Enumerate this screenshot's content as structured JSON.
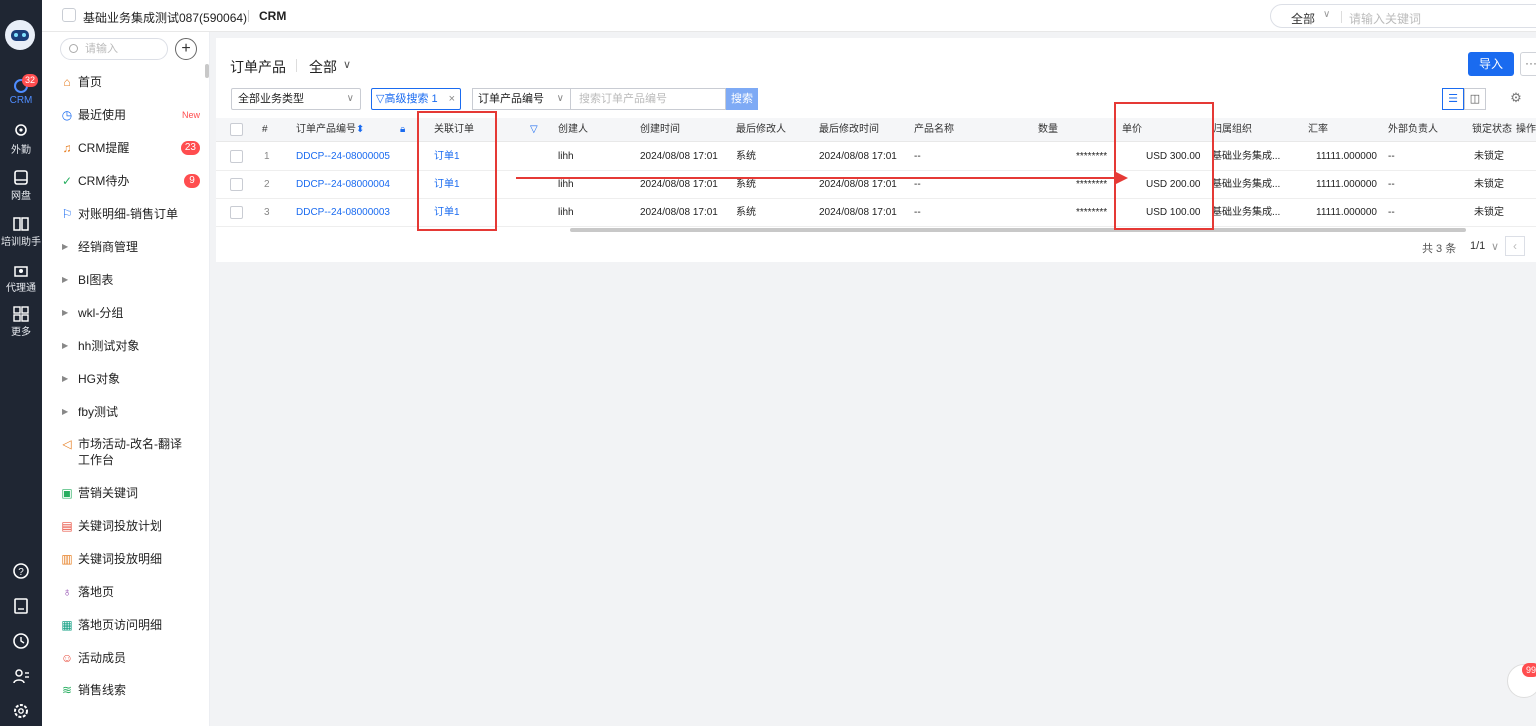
{
  "rail": {
    "items": [
      {
        "label": "CRM",
        "badge": "32"
      },
      {
        "label": "外勤"
      },
      {
        "label": "网盘"
      },
      {
        "label": "培训助手"
      },
      {
        "label": "代理通"
      },
      {
        "label": "更多"
      }
    ]
  },
  "topbar": {
    "tenant": "基础业务集成测试087(590064)",
    "module": "CRM",
    "scope": "全部",
    "search_placeholder": "请输入关键词"
  },
  "menu": {
    "search_placeholder": "请输入",
    "items": [
      {
        "label": "首页",
        "icon": "home-icon"
      },
      {
        "label": "最近使用",
        "icon": "clock-icon",
        "tag": "New"
      },
      {
        "label": "CRM提醒",
        "icon": "bell-icon",
        "count": "23"
      },
      {
        "label": "CRM待办",
        "icon": "check-circle-icon",
        "count": "9"
      },
      {
        "label": "对账明细-销售订单",
        "icon": "flag-icon"
      },
      {
        "label": "经销商管理"
      },
      {
        "label": "BI图表"
      },
      {
        "label": "wkl-分组"
      },
      {
        "label": "hh测试对象"
      },
      {
        "label": "HG对象"
      },
      {
        "label": "fby测试"
      },
      {
        "label": "市场活动-改名-翻译工作台",
        "icon": "megaphone-icon"
      },
      {
        "label": "营销关键词",
        "icon": "keyword-icon"
      },
      {
        "label": "关键词投放计划",
        "icon": "plan-icon"
      },
      {
        "label": "关键词投放明细",
        "icon": "detail-icon"
      },
      {
        "label": "落地页",
        "icon": "landing-icon"
      },
      {
        "label": "落地页访问明细",
        "icon": "visit-icon"
      },
      {
        "label": "活动成员",
        "icon": "member-icon"
      },
      {
        "label": "销售线索",
        "icon": "lead-icon"
      }
    ]
  },
  "main": {
    "title": "订单产品",
    "scope": "全部",
    "import_label": "导入",
    "more_label": "···",
    "biz_type": "全部业务类型",
    "adv_search": "高级搜索",
    "adv_count": "1",
    "field_select": "订单产品编号",
    "keyword_placeholder": "搜索订单产品编号",
    "search_label": "搜索",
    "total": "共 3 条",
    "page": "1/1"
  },
  "table": {
    "headers": [
      "#",
      "订单产品编号",
      "关联订单",
      "创建人",
      "创建时间",
      "最后修改人",
      "最后修改时间",
      "产品名称",
      "数量",
      "单价",
      "归属组织",
      "汇率",
      "外部负责人",
      "锁定状态",
      "操作"
    ],
    "rows": [
      [
        "1",
        "DDCP--24-08000005",
        "订单1",
        "lihh",
        "2024/08/08 17:01",
        "系统",
        "2024/08/08 17:01",
        "--",
        "********",
        "USD 300.00",
        "基础业务集成...",
        "11111.000000",
        "--",
        "未锁定"
      ],
      [
        "2",
        "DDCP--24-08000004",
        "订单1",
        "lihh",
        "2024/08/08 17:01",
        "系统",
        "2024/08/08 17:01",
        "--",
        "********",
        "USD 200.00",
        "基础业务集成...",
        "11111.000000",
        "--",
        "未锁定"
      ],
      [
        "3",
        "DDCP--24-08000003",
        "订单1",
        "lihh",
        "2024/08/08 17:01",
        "系统",
        "2024/08/08 17:01",
        "--",
        "********",
        "USD 100.00",
        "基础业务集成...",
        "11111.000000",
        "--",
        "未锁定"
      ]
    ]
  },
  "chat_badge": "99",
  "colors": {
    "accent": "#1a6bf0",
    "annotation": "#e53935",
    "rail": "#1f2633"
  }
}
